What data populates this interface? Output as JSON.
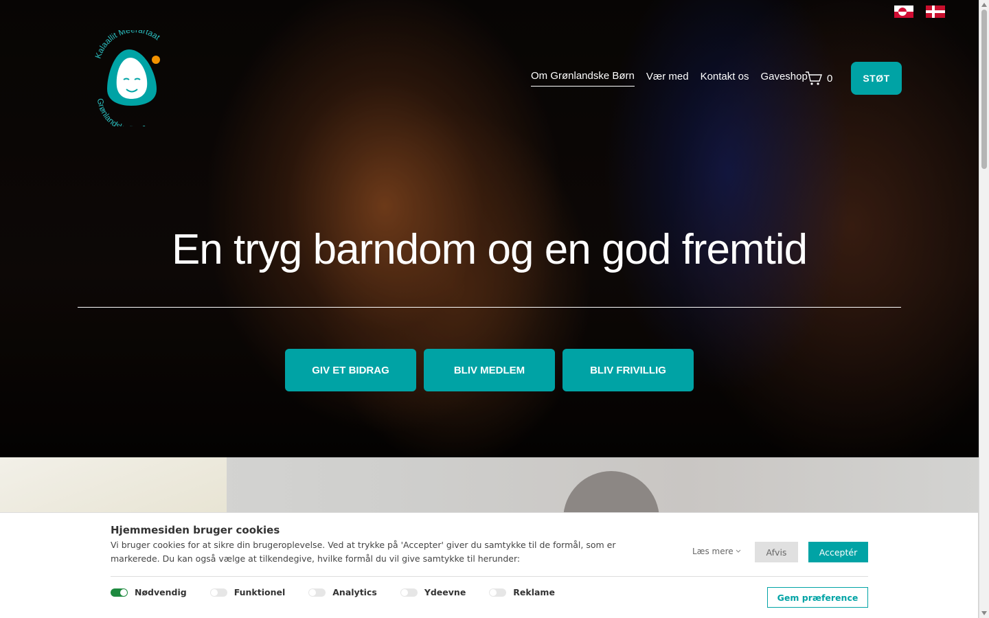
{
  "header": {
    "logo": {
      "text_top": "Kalaallit Meerartaat",
      "text_bottom": "Grønlandske Børn",
      "brand_color": "#00a3a5"
    },
    "languages": [
      {
        "name": "greenland-flag-icon"
      },
      {
        "name": "denmark-flag-icon"
      }
    ],
    "nav": [
      {
        "label": "Om Grønlandske Børn",
        "active": true
      },
      {
        "label": "Vær med"
      },
      {
        "label": "Kontakt os"
      },
      {
        "label": "Gaveshop"
      }
    ],
    "cart": {
      "icon": "cart-icon",
      "count": "0"
    },
    "support_button": "STØT"
  },
  "hero": {
    "headline": "En tryg barndom og en god fremtid",
    "buttons": [
      "GIV ET BIDRAG",
      "BLIV MEDLEM",
      "BLIV FRIVILLIG"
    ]
  },
  "cookie_banner": {
    "title": "Hjemmesiden bruger cookies",
    "text": "Vi bruger cookies for at sikre din brugeroplevelse. Ved at trykke på 'Accepter' giver du samtykke til de formål, som er markerede. Du kan også vælge at tilkendegive, hvilke formål du vil give samtykke til herunder:",
    "read_more": "Læs mere",
    "decline": "Afvis",
    "accept": "Acceptér",
    "save": "Gem præference",
    "categories": [
      {
        "label": "Nødvendig",
        "on": true
      },
      {
        "label": "Funktionel",
        "on": false
      },
      {
        "label": "Analytics",
        "on": false
      },
      {
        "label": "Ydeevne",
        "on": false
      },
      {
        "label": "Reklame",
        "on": false
      }
    ]
  },
  "colors": {
    "accent": "#00a3a5",
    "toggle_on": "#1e8a3f"
  }
}
